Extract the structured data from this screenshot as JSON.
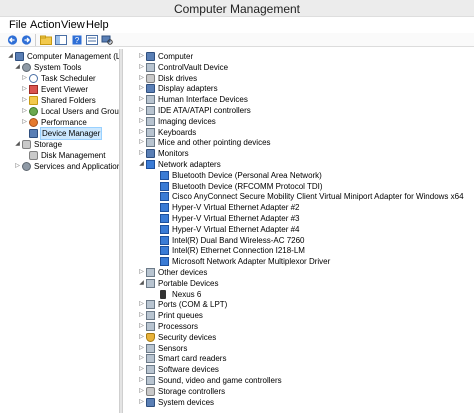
{
  "window": {
    "title": "Computer Management"
  },
  "menu": [
    "File",
    "Action",
    "View",
    "Help"
  ],
  "toolbar": {
    "buttons": [
      "back-arrow-icon",
      "forward-arrow-icon",
      "up-folder-icon",
      "show-hide-tree-icon",
      "help-icon",
      "properties-icon",
      "scan-hardware-icon"
    ]
  },
  "left_tree": [
    {
      "label": "Computer Management (Local",
      "level": 0,
      "expand": "v",
      "icon": "computer"
    },
    {
      "label": "System Tools",
      "level": 1,
      "expand": "v",
      "icon": "gear"
    },
    {
      "label": "Task Scheduler",
      "level": 2,
      "expand": ">",
      "icon": "clock"
    },
    {
      "label": "Event Viewer",
      "level": 2,
      "expand": ">",
      "icon": "log"
    },
    {
      "label": "Shared Folders",
      "level": 2,
      "expand": ">",
      "icon": "folder"
    },
    {
      "label": "Local Users and Groups",
      "level": 2,
      "expand": ">",
      "icon": "users"
    },
    {
      "label": "Performance",
      "level": 2,
      "expand": ">",
      "icon": "perf"
    },
    {
      "label": "Device Manager",
      "level": 2,
      "expand": "",
      "icon": "computer",
      "selected": true
    },
    {
      "label": "Storage",
      "level": 1,
      "expand": "v",
      "icon": "disk"
    },
    {
      "label": "Disk Management",
      "level": 2,
      "expand": "",
      "icon": "disk"
    },
    {
      "label": "Services and Applications",
      "level": 1,
      "expand": ">",
      "icon": "gear"
    }
  ],
  "device_tree": [
    {
      "label": "Computer",
      "level": 0,
      "expand": ">",
      "icon": "computer"
    },
    {
      "label": "ControlVault Device",
      "level": 0,
      "expand": ">",
      "icon": "dev"
    },
    {
      "label": "Disk drives",
      "level": 0,
      "expand": ">",
      "icon": "disk"
    },
    {
      "label": "Display adapters",
      "level": 0,
      "expand": ">",
      "icon": "computer"
    },
    {
      "label": "Human Interface Devices",
      "level": 0,
      "expand": ">",
      "icon": "dev"
    },
    {
      "label": "IDE ATA/ATAPI controllers",
      "level": 0,
      "expand": ">",
      "icon": "dev"
    },
    {
      "label": "Imaging devices",
      "level": 0,
      "expand": ">",
      "icon": "dev"
    },
    {
      "label": "Keyboards",
      "level": 0,
      "expand": ">",
      "icon": "dev"
    },
    {
      "label": "Mice and other pointing devices",
      "level": 0,
      "expand": ">",
      "icon": "dev"
    },
    {
      "label": "Monitors",
      "level": 0,
      "expand": ">",
      "icon": "computer"
    },
    {
      "label": "Network adapters",
      "level": 0,
      "expand": "v",
      "icon": "net"
    },
    {
      "label": "Bluetooth Device (Personal Area Network)",
      "level": 1,
      "expand": "",
      "icon": "net"
    },
    {
      "label": "Bluetooth Device (RFCOMM Protocol TDI)",
      "level": 1,
      "expand": "",
      "icon": "net"
    },
    {
      "label": "Cisco AnyConnect Secure Mobility Client Virtual Miniport Adapter for Windows x64",
      "level": 1,
      "expand": "",
      "icon": "net"
    },
    {
      "label": "Hyper-V Virtual Ethernet Adapter #2",
      "level": 1,
      "expand": "",
      "icon": "net"
    },
    {
      "label": "Hyper-V Virtual Ethernet Adapter #3",
      "level": 1,
      "expand": "",
      "icon": "net"
    },
    {
      "label": "Hyper-V Virtual Ethernet Adapter #4",
      "level": 1,
      "expand": "",
      "icon": "net"
    },
    {
      "label": "Intel(R) Dual Band Wireless-AC 7260",
      "level": 1,
      "expand": "",
      "icon": "net"
    },
    {
      "label": "Intel(R) Ethernet Connection I218-LM",
      "level": 1,
      "expand": "",
      "icon": "net"
    },
    {
      "label": "Microsoft Network Adapter Multiplexor Driver",
      "level": 1,
      "expand": "",
      "icon": "net"
    },
    {
      "label": "Other devices",
      "level": 0,
      "expand": ">",
      "icon": "dev"
    },
    {
      "label": "Portable Devices",
      "level": 0,
      "expand": "v",
      "icon": "dev"
    },
    {
      "label": "Nexus 6",
      "level": 1,
      "expand": "",
      "icon": "phone"
    },
    {
      "label": "Ports (COM & LPT)",
      "level": 0,
      "expand": ">",
      "icon": "dev"
    },
    {
      "label": "Print queues",
      "level": 0,
      "expand": ">",
      "icon": "dev"
    },
    {
      "label": "Processors",
      "level": 0,
      "expand": ">",
      "icon": "dev"
    },
    {
      "label": "Security devices",
      "level": 0,
      "expand": ">",
      "icon": "shield"
    },
    {
      "label": "Sensors",
      "level": 0,
      "expand": ">",
      "icon": "dev"
    },
    {
      "label": "Smart card readers",
      "level": 0,
      "expand": ">",
      "icon": "dev"
    },
    {
      "label": "Software devices",
      "level": 0,
      "expand": ">",
      "icon": "dev"
    },
    {
      "label": "Sound, video and game controllers",
      "level": 0,
      "expand": ">",
      "icon": "dev"
    },
    {
      "label": "Storage controllers",
      "level": 0,
      "expand": ">",
      "icon": "disk"
    },
    {
      "label": "System devices",
      "level": 0,
      "expand": ">",
      "icon": "computer"
    }
  ]
}
